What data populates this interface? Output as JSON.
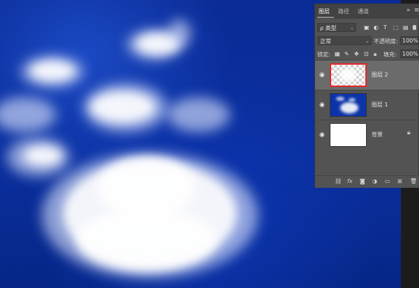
{
  "panel": {
    "tabs": [
      "图层",
      "路径",
      "通道"
    ],
    "active_tab_index": 0,
    "collapse_icon": "double-chevron-right-icon",
    "filter": {
      "kind_label": "ρ 类型",
      "icons": [
        "image-filter-icon",
        "adjustment-filter-icon",
        "type-filter-icon",
        "shape-filter-icon",
        "smart-object-filter-icon"
      ]
    },
    "blend": {
      "mode": "正常",
      "opacity_label": "不透明度:",
      "opacity_value": "100%"
    },
    "lock": {
      "label": "锁定:",
      "fill_label": "填充:",
      "fill_value": "100%"
    },
    "layers": [
      {
        "name": "图层 2",
        "visible": true,
        "selected": true,
        "thumb": "cloud-transparent",
        "locked": false
      },
      {
        "name": "图层 1",
        "visible": true,
        "selected": false,
        "thumb": "blue-sky-clouds",
        "locked": false
      },
      {
        "name": "背景",
        "visible": true,
        "selected": false,
        "thumb": "white",
        "locked": true
      }
    ],
    "bottom_icons": [
      "link-layers-icon",
      "fx-icon",
      "add-mask-icon",
      "adjustment-layer-icon",
      "group-folder-icon",
      "new-layer-icon",
      "trash-icon"
    ],
    "highlight_color": "#e8242a"
  },
  "canvas": {
    "background_color": "#0a2f9e"
  }
}
